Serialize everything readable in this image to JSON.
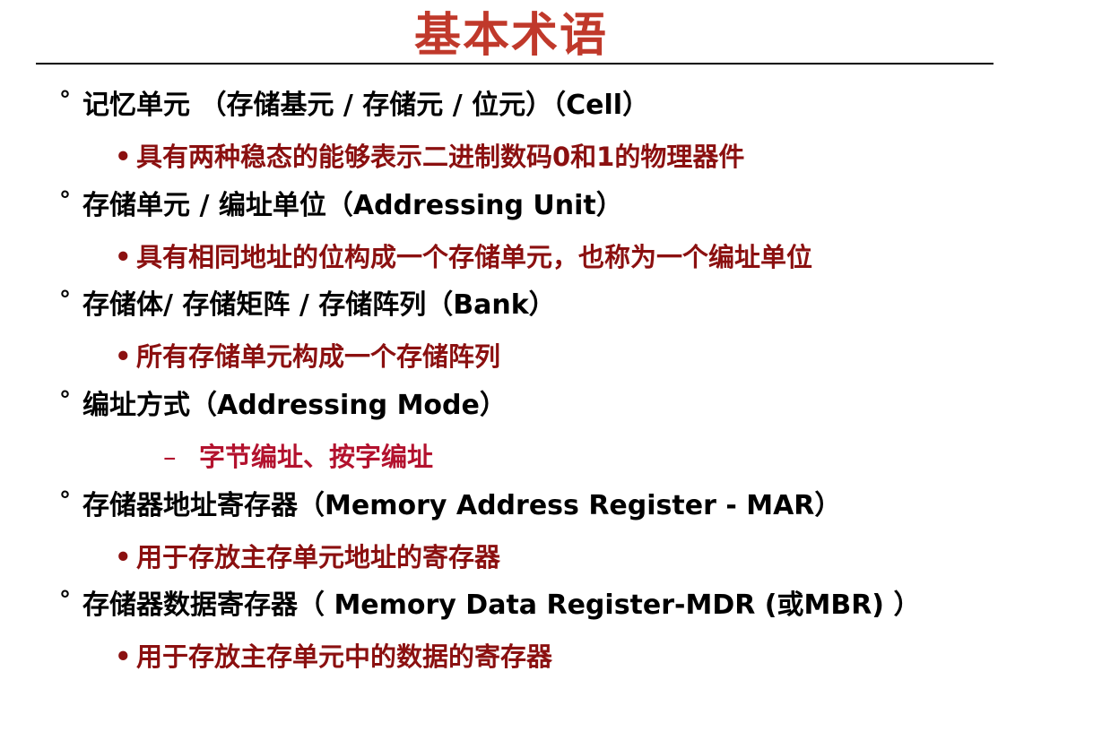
{
  "title": "基本术语",
  "colors": {
    "title": "#c0392b",
    "term": "#000000",
    "definition": "#8b1010",
    "sub_definition": "#b3122e"
  },
  "markers": {
    "term": "°",
    "definition": "•",
    "sub_definition": "–"
  },
  "items": [
    {
      "term": "记忆单元 （存储基元 / 存储元 / 位元）（Cell）",
      "definition": "具有两种稳态的能够表示二进制数码0和1的物理器件"
    },
    {
      "term": "存储单元 / 编址单位（Addressing Unit）",
      "definition": "具有相同地址的位构成一个存储单元，也称为一个编址单位"
    },
    {
      "term": "存储体/ 存储矩阵 / 存储阵列（Bank）",
      "definition": "所有存储单元构成一个存储阵列"
    },
    {
      "term": "编址方式（Addressing Mode）",
      "definition": "字节编址、按字编址"
    },
    {
      "term": "存储器地址寄存器（Memory Address Register - MAR）",
      "definition": "用于存放主存单元地址的寄存器"
    },
    {
      "term": "存储器数据寄存器（ Memory Data Register-MDR (或MBR) ）",
      "definition": "用于存放主存单元中的数据的寄存器"
    }
  ]
}
